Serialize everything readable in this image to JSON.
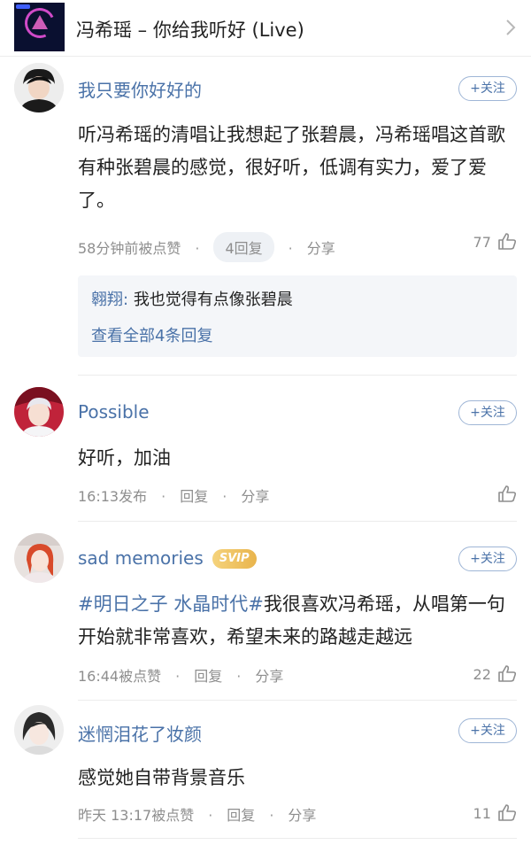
{
  "header": {
    "song_title": "冯希瑶 – 你给我听好 (Live)"
  },
  "comments": [
    {
      "username": "我只要你好好的",
      "follow_label": "+关注",
      "text": "听冯希瑶的清唱让我想起了张碧晨，冯希瑶唱这首歌有种张碧晨的感觉，很好听，低调有实力，爱了爱了。",
      "time": "58分钟前被点赞",
      "reply_label": "4回复",
      "share_label": "分享",
      "likes": "77",
      "subreply": {
        "user": "翱翔:",
        "text": "我也觉得有点像张碧晨",
        "view_all": "查看全部4条回复"
      }
    },
    {
      "username": "Possible",
      "follow_label": "+关注",
      "text": "好听，加油",
      "time": "16:13发布",
      "reply_label": "回复",
      "share_label": "分享",
      "likes": ""
    },
    {
      "username": "sad memories",
      "badge": "SVIP",
      "follow_label": "+关注",
      "tag": "#明日之子 水晶时代#",
      "text": "我很喜欢冯希瑶，从唱第一句开始就非常喜欢，希望未来的路越走越远",
      "time": "16:44被点赞",
      "reply_label": "回复",
      "share_label": "分享",
      "likes": "22"
    },
    {
      "username": "迷惘泪花了妆颜",
      "follow_label": "+关注",
      "text": "感觉她自带背景音乐",
      "time": "昨天 13:17被点赞",
      "reply_label": "回复",
      "share_label": "分享",
      "likes": "11"
    }
  ],
  "colors": {
    "link": "#4a72a8",
    "meta": "#8e8e8e",
    "svip": "#e9b44c"
  }
}
